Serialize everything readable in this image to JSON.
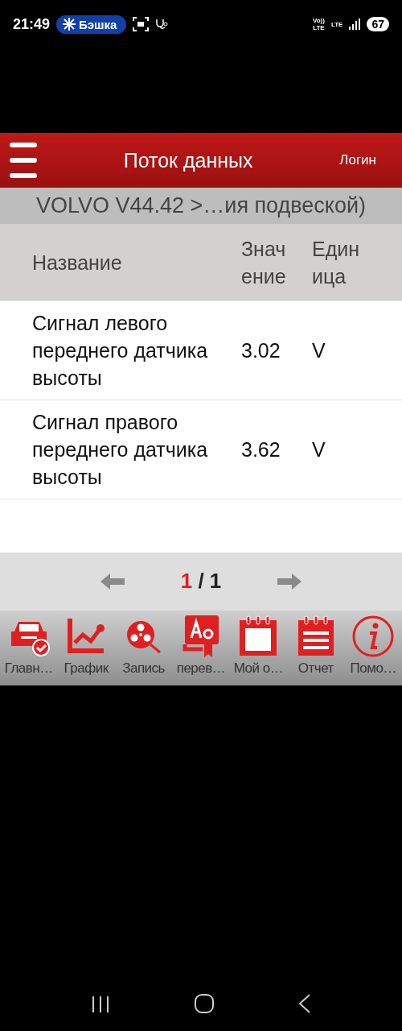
{
  "status_bar": {
    "time": "21:49",
    "chip_label": "Бэшка",
    "volte_top": "Vo))",
    "volte_bottom": "LTE",
    "network": "LTE",
    "battery": "67"
  },
  "header": {
    "title": "Поток данных",
    "login": "Логин"
  },
  "breadcrumb": "VOLVO V44.42 >…ия подвеской)",
  "table": {
    "columns": [
      "Название",
      "Значение",
      "Единица"
    ],
    "rows": [
      {
        "name": "Сигнал левого переднего датчика высоты",
        "value": "3.02",
        "unit": "V"
      },
      {
        "name": "Сигнал правого переднего датчика высоты",
        "value": "3.62",
        "unit": "V"
      }
    ]
  },
  "pagination": {
    "current": "1",
    "separator": "/",
    "total": "1"
  },
  "toolbar": [
    {
      "kind": "car",
      "label": "Главн…"
    },
    {
      "kind": "graph",
      "label": "График"
    },
    {
      "kind": "record",
      "label": "Запись"
    },
    {
      "kind": "translate",
      "label": "перев…"
    },
    {
      "kind": "calendar",
      "label": "Мой о…"
    },
    {
      "kind": "report",
      "label": "Отчет"
    },
    {
      "kind": "info",
      "label": "Помо…"
    }
  ]
}
